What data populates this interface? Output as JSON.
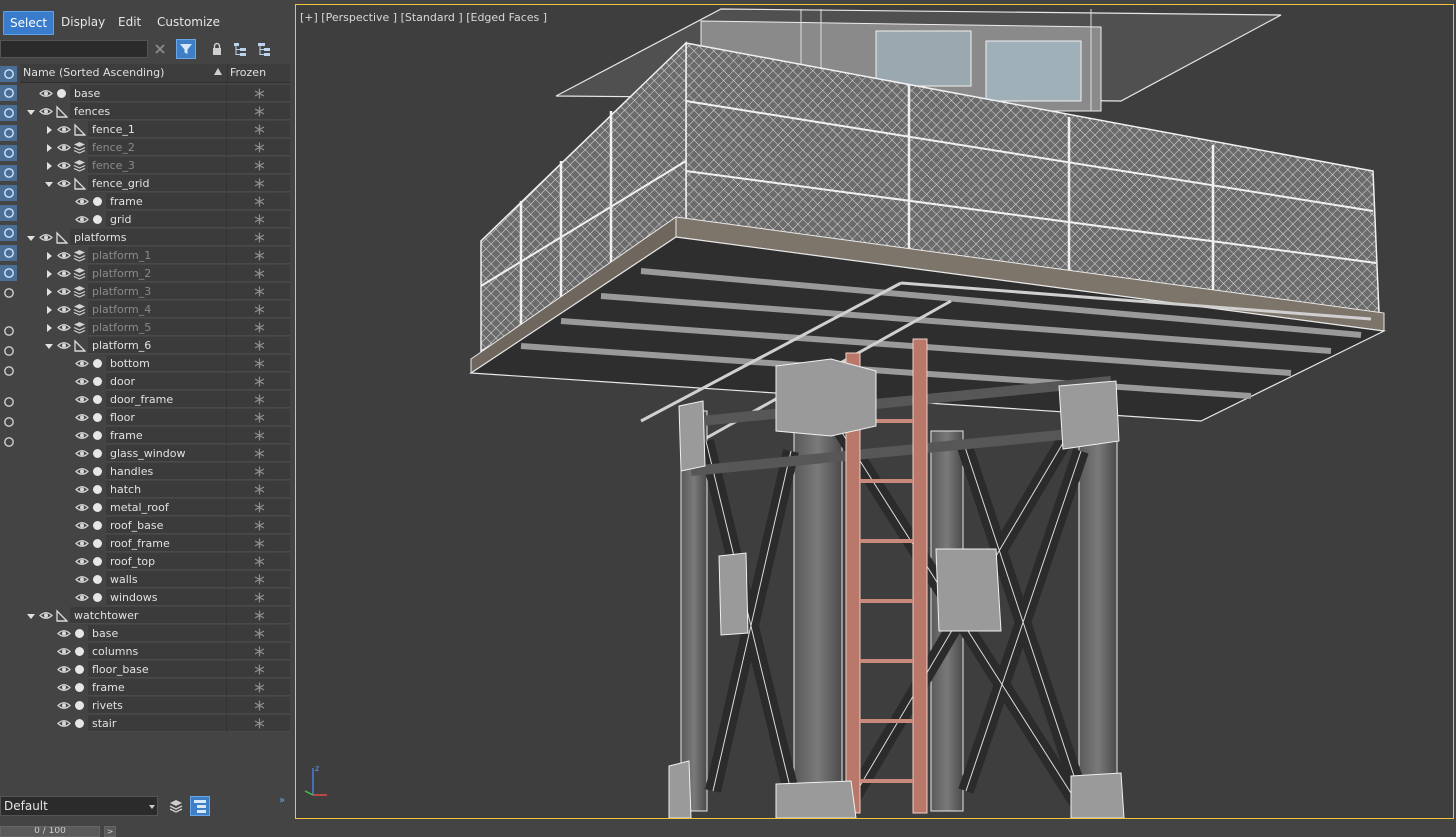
{
  "menu": {
    "items": [
      "Select",
      "Display",
      "Edit",
      "Customize"
    ],
    "active": "Select"
  },
  "search": {
    "value": "",
    "placeholder": ""
  },
  "columns": {
    "name": "Name (Sorted Ascending)",
    "frozen": "Frozen"
  },
  "tree": [
    {
      "label": "base",
      "depth": 0,
      "arrow": "none",
      "kind": "object",
      "dim": false
    },
    {
      "label": "fences",
      "depth": 0,
      "arrow": "down",
      "kind": "group",
      "dim": false
    },
    {
      "label": "fence_1",
      "depth": 1,
      "arrow": "right",
      "kind": "group",
      "dim": false
    },
    {
      "label": "fence_2",
      "depth": 1,
      "arrow": "right",
      "kind": "layers",
      "dim": true
    },
    {
      "label": "fence_3",
      "depth": 1,
      "arrow": "right",
      "kind": "layers",
      "dim": true
    },
    {
      "label": "fence_grid",
      "depth": 1,
      "arrow": "down",
      "kind": "group",
      "dim": false
    },
    {
      "label": "frame",
      "depth": 2,
      "arrow": "none",
      "kind": "object",
      "dim": false
    },
    {
      "label": "grid",
      "depth": 2,
      "arrow": "none",
      "kind": "object",
      "dim": false
    },
    {
      "label": "platforms",
      "depth": 0,
      "arrow": "down",
      "kind": "group",
      "dim": false
    },
    {
      "label": "platform_1",
      "depth": 1,
      "arrow": "right",
      "kind": "layers",
      "dim": true
    },
    {
      "label": "platform_2",
      "depth": 1,
      "arrow": "right",
      "kind": "layers",
      "dim": true
    },
    {
      "label": "platform_3",
      "depth": 1,
      "arrow": "right",
      "kind": "layers",
      "dim": true
    },
    {
      "label": "platform_4",
      "depth": 1,
      "arrow": "right",
      "kind": "layers",
      "dim": true
    },
    {
      "label": "platform_5",
      "depth": 1,
      "arrow": "right",
      "kind": "layers",
      "dim": true
    },
    {
      "label": "platform_6",
      "depth": 1,
      "arrow": "down",
      "kind": "group",
      "dim": false
    },
    {
      "label": "bottom",
      "depth": 2,
      "arrow": "none",
      "kind": "object",
      "dim": false
    },
    {
      "label": "door",
      "depth": 2,
      "arrow": "none",
      "kind": "object",
      "dim": false
    },
    {
      "label": "door_frame",
      "depth": 2,
      "arrow": "none",
      "kind": "object",
      "dim": false
    },
    {
      "label": "floor",
      "depth": 2,
      "arrow": "none",
      "kind": "object",
      "dim": false
    },
    {
      "label": "frame",
      "depth": 2,
      "arrow": "none",
      "kind": "object",
      "dim": false
    },
    {
      "label": "glass_window",
      "depth": 2,
      "arrow": "none",
      "kind": "object",
      "dim": false
    },
    {
      "label": "handles",
      "depth": 2,
      "arrow": "none",
      "kind": "object",
      "dim": false
    },
    {
      "label": "hatch",
      "depth": 2,
      "arrow": "none",
      "kind": "object",
      "dim": false
    },
    {
      "label": "metal_roof",
      "depth": 2,
      "arrow": "none",
      "kind": "object",
      "dim": false
    },
    {
      "label": "roof_base",
      "depth": 2,
      "arrow": "none",
      "kind": "object",
      "dim": false
    },
    {
      "label": "roof_frame",
      "depth": 2,
      "arrow": "none",
      "kind": "object",
      "dim": false
    },
    {
      "label": "roof_top",
      "depth": 2,
      "arrow": "none",
      "kind": "object",
      "dim": false
    },
    {
      "label": "walls",
      "depth": 2,
      "arrow": "none",
      "kind": "object",
      "dim": false
    },
    {
      "label": "windows",
      "depth": 2,
      "arrow": "none",
      "kind": "object",
      "dim": false
    },
    {
      "label": "watchtower",
      "depth": 0,
      "arrow": "down",
      "kind": "group",
      "dim": false
    },
    {
      "label": "base",
      "depth": 1,
      "arrow": "none",
      "kind": "object",
      "dim": false
    },
    {
      "label": "columns",
      "depth": 1,
      "arrow": "none",
      "kind": "object",
      "dim": false
    },
    {
      "label": "floor_base",
      "depth": 1,
      "arrow": "none",
      "kind": "object",
      "dim": false
    },
    {
      "label": "frame",
      "depth": 1,
      "arrow": "none",
      "kind": "object",
      "dim": false
    },
    {
      "label": "rivets",
      "depth": 1,
      "arrow": "none",
      "kind": "object",
      "dim": false
    },
    {
      "label": "stair",
      "depth": 1,
      "arrow": "none",
      "kind": "object",
      "dim": false
    }
  ],
  "bottom": {
    "layer": "Default",
    "frame_counter": "0 / 100",
    "next_symbol": ">"
  },
  "viewport": {
    "label": "[+] [Perspective ] [Standard ] [Edged Faces ]"
  },
  "colors": {
    "accent": "#3a7ccc",
    "panel": "#444444",
    "row": "#3b3b3b",
    "viewport_border": "#f2c33c",
    "ladder": "#b9786a"
  },
  "icons": {
    "side": [
      "sphere-icon",
      "geometry-icon",
      "light-icon",
      "camera-icon",
      "helper-icon",
      "spacewarp-icon",
      "group-icon",
      "xref-icon",
      "bone-icon",
      "container-icon",
      "frozen-icon",
      "hidden-icon",
      "layer-list-icon",
      "object-icon",
      "properties-icon",
      "filter-funnel-icon",
      "filter-icon",
      "hierarchy-icon"
    ],
    "toolbar": [
      "clear-icon",
      "filter-toggle-icon",
      "lock-icon",
      "expand-hierarchy-icon",
      "collapse-hierarchy-icon"
    ]
  }
}
